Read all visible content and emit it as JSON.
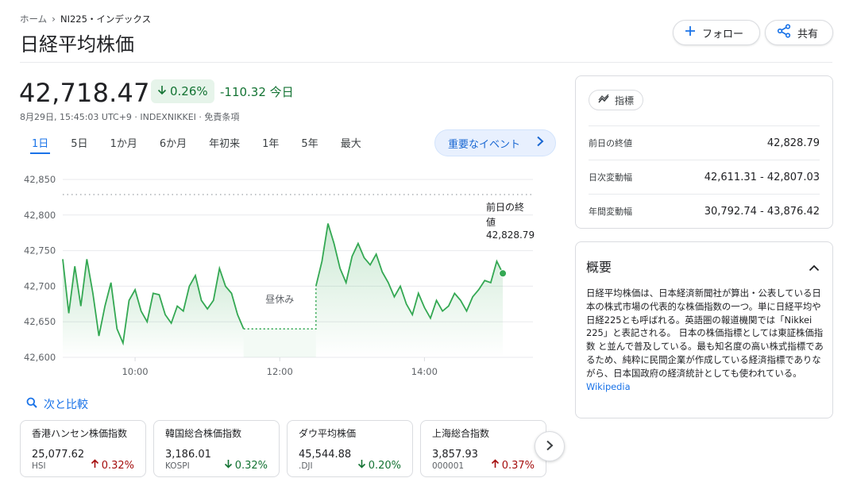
{
  "breadcrumb": {
    "home": "ホーム",
    "current": "NI225・インデックス"
  },
  "title": "日経平均株価",
  "actions": {
    "follow": "フォロー",
    "share": "共有"
  },
  "quote": {
    "price": "42,718.47",
    "change_pct": "0.26%",
    "change_abs": "-110.32 今日",
    "meta": "8月29日, 15:45:03 UTC+9 · INDEXNIKKEI · 免責条項"
  },
  "ranges": [
    "1日",
    "5日",
    "1か月",
    "6か月",
    "年初来",
    "1年",
    "5年",
    "最大"
  ],
  "selected_range": "1日",
  "events_button": "重要なイベント",
  "chart_data": {
    "type": "line",
    "y_ticks": [
      "42,850",
      "42,800",
      "42,750",
      "42,700",
      "42,650",
      "42,600"
    ],
    "x_ticks": [
      "10:00",
      "12:00",
      "14:00"
    ],
    "ylim": [
      42600,
      42850
    ],
    "prev_close": 42828.79,
    "prev_close_label_1": "前日の終",
    "prev_close_label_2": "値",
    "prev_close_value": "42,828.79",
    "lunch_label": "昼休み",
    "line_color": "#34a853",
    "morning": {
      "start": "09:00",
      "step_min": 5,
      "values": [
        42738,
        42662,
        42728,
        42672,
        42738,
        42690,
        42630,
        42672,
        42705,
        42640,
        42620,
        42680,
        42695,
        42665,
        42650,
        42690,
        42688,
        42660,
        42648,
        42672,
        42665,
        42700,
        42715,
        42680,
        42668,
        42680,
        42725,
        42700,
        42690,
        42660,
        42640
      ]
    },
    "afternoon": {
      "start": "12:30",
      "step_min": 5,
      "values": [
        42700,
        42735,
        42788,
        42760,
        42725,
        42705,
        42742,
        42760,
        42740,
        42730,
        42745,
        42720,
        42705,
        42685,
        42700,
        42675,
        42660,
        42690,
        42670,
        42655,
        42680,
        42665,
        42672,
        42690,
        42680,
        42665,
        42685,
        42695,
        42708,
        42705,
        42735,
        42718
      ]
    }
  },
  "compare": {
    "title": "次と比較",
    "items": [
      {
        "name": "香港ハンセン株価指数",
        "value": "25,077.62",
        "symbol": "HSI",
        "change": "0.32%",
        "dir": "up"
      },
      {
        "name": "韓国総合株価指数",
        "value": "3,186.01",
        "symbol": "KOSPI",
        "change": "0.32%",
        "dir": "down"
      },
      {
        "name": "ダウ平均株価",
        "value": "45,544.88",
        "symbol": ".DJI",
        "change": "0.20%",
        "dir": "down"
      },
      {
        "name": "上海総合指数",
        "value": "3,857.93",
        "symbol": "000001",
        "change": "0.37%",
        "dir": "up"
      }
    ]
  },
  "stats": {
    "indicator_button": "指標",
    "rows": [
      {
        "label": "前日の終値",
        "value": "42,828.79"
      },
      {
        "label": "日次変動幅",
        "value": "42,611.31 - 42,807.03"
      },
      {
        "label": "年間変動幅",
        "value": "30,792.74 - 43,876.42"
      }
    ]
  },
  "about": {
    "title": "概要",
    "text": "日経平均株価は、日本経済新聞社が算出・公表している日本の株式市場の代表的な株価指数の一つ。単に日経平均や日経225とも呼ばれる。英語圏の報道機関では「Nikkei 225」と表記される。 日本の株価指標としては東証株価指数 と並んで普及している。最も知名度の高い株式指標であるため、純粋に民間企業が作成している経済指標でありながら、日本国政府の経済統計としても使われている。",
    "link": "Wikipedia"
  }
}
